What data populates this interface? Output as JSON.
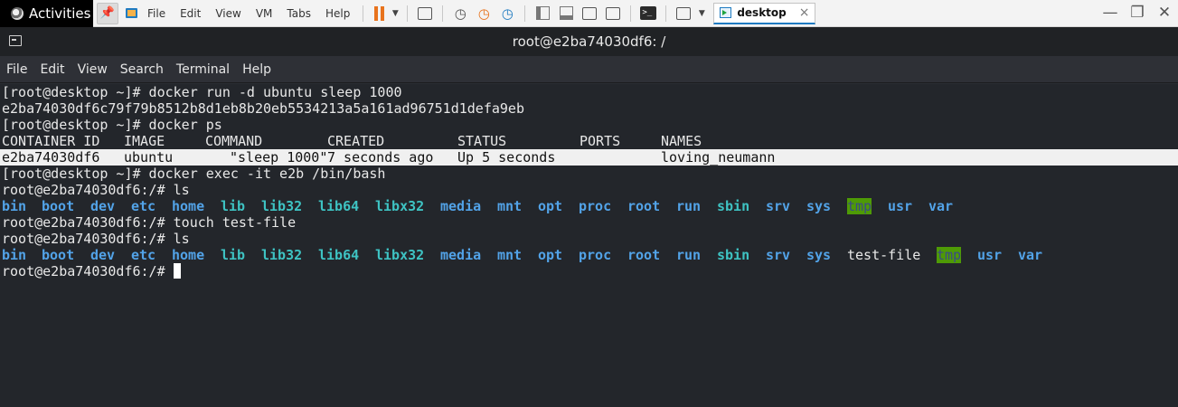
{
  "topbar": {
    "activities": "Activities",
    "menus": [
      "File",
      "Edit",
      "View",
      "VM",
      "Tabs",
      "Help"
    ],
    "tab_label": "desktop",
    "tab_close": "×"
  },
  "window": {
    "title": "root@e2ba74030df6: /"
  },
  "terminal_menu": [
    "File",
    "Edit",
    "View",
    "Search",
    "Terminal",
    "Help"
  ],
  "terminal": {
    "lines": [
      "[root@desktop ~]# docker run -d ubuntu sleep 1000",
      "e2ba74030df6c79f79b8512b8d1eb8b20eb5534213a5a161ad96751d1defa9eb",
      "[root@desktop ~]# docker ps",
      "[root@desktop ~]# docker exec -it e2b /bin/bash",
      "root@e2ba74030df6:/# ls",
      "root@e2ba74030df6:/# touch test-file",
      "root@e2ba74030df6:/# ls",
      "root@e2ba74030df6:/# "
    ],
    "ps_headers": [
      "CONTAINER ID",
      "IMAGE",
      "COMMAND",
      "CREATED",
      "STATUS",
      "PORTS",
      "NAMES"
    ],
    "ps_row": [
      "e2ba74030df6",
      "ubuntu",
      "\"sleep 1000\"",
      "7 seconds ago",
      "Up 5 seconds",
      "",
      "loving_neumann"
    ],
    "ls1": [
      "bin",
      "boot",
      "dev",
      "etc",
      "home",
      "lib",
      "lib32",
      "lib64",
      "libx32",
      "media",
      "mnt",
      "opt",
      "proc",
      "root",
      "run",
      "sbin",
      "srv",
      "sys",
      "tmp",
      "usr",
      "var"
    ],
    "ls2": [
      "bin",
      "boot",
      "dev",
      "etc",
      "home",
      "lib",
      "lib32",
      "lib64",
      "libx32",
      "media",
      "mnt",
      "opt",
      "proc",
      "root",
      "run",
      "sbin",
      "srv",
      "sys",
      "test-file",
      "tmp",
      "usr",
      "var"
    ]
  },
  "colors": {
    "directory": "#52a3e8",
    "symlink": "#3ec3c3",
    "sticky_dir_bg": "#4e9a06",
    "terminal_bg": "#23262b"
  }
}
